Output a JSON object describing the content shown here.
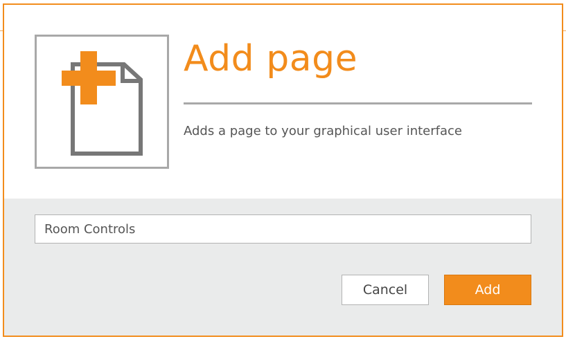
{
  "dialog": {
    "title": "Add page",
    "description": "Adds a page to your graphical user interface",
    "icon": "add-page-icon",
    "accent_color": "#f28c1c",
    "page_name_input": {
      "value": "Room Controls"
    },
    "buttons": {
      "cancel_label": "Cancel",
      "add_label": "Add"
    }
  },
  "colors": {
    "accent": "#f28c1c",
    "border_gray": "#a8a8a8",
    "footer_bg": "#eaebeb"
  }
}
